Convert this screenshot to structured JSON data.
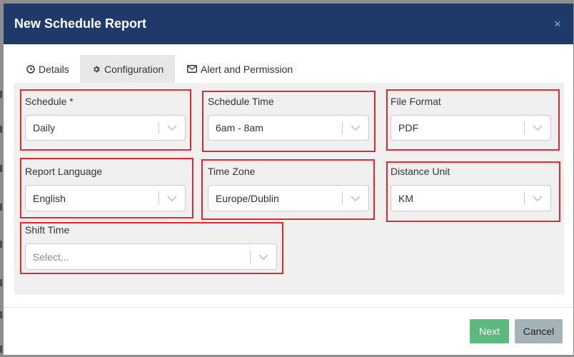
{
  "dialog": {
    "title": "New Schedule Report",
    "close_label": "×"
  },
  "tabs": [
    {
      "label": "Details",
      "icon": "clock-icon",
      "active": false
    },
    {
      "label": "Configuration",
      "icon": "gear-icon",
      "active": true
    },
    {
      "label": "Alert and Permission",
      "icon": "envelope-icon",
      "active": false
    }
  ],
  "form": {
    "schedule": {
      "label": "Schedule *",
      "value": "Daily"
    },
    "schedule_time": {
      "label": "Schedule Time",
      "value": "6am - 8am"
    },
    "file_format": {
      "label": "File Format",
      "value": "PDF"
    },
    "report_language": {
      "label": "Report Language",
      "value": "English"
    },
    "time_zone": {
      "label": "Time Zone",
      "value": "Europe/Dublin"
    },
    "distance_unit": {
      "label": "Distance Unit",
      "value": "KM"
    },
    "shift_time": {
      "label": "Shift Time",
      "placeholder": "Select..."
    }
  },
  "footer": {
    "next_label": "Next",
    "cancel_label": "Cancel"
  },
  "colors": {
    "header_bg": "#1f3a69",
    "active_tab_bg": "#e7e7e7",
    "panel_bg": "#f0f0f0",
    "next_button": "#5cb97f",
    "cancel_button": "#a6b2b9",
    "highlight": "#e3272d"
  }
}
